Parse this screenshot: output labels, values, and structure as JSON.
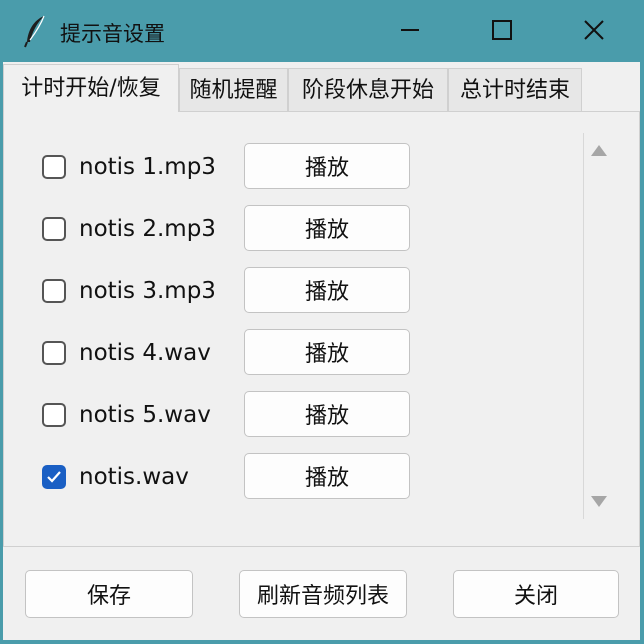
{
  "window": {
    "title": "提示音设置",
    "icon": "feather-icon",
    "controls": {
      "minimize": "minimize-icon",
      "maximize": "maximize-icon",
      "close": "close-icon"
    }
  },
  "tabs": [
    {
      "label": "计时开始/恢复",
      "active": true
    },
    {
      "label": "随机提醒",
      "active": false
    },
    {
      "label": "阶段休息开始",
      "active": false
    },
    {
      "label": "总计时结束",
      "active": false
    }
  ],
  "sounds": [
    {
      "file": "notis 1.mp3",
      "checked": false,
      "play_label": "播放"
    },
    {
      "file": "notis 2.mp3",
      "checked": false,
      "play_label": "播放"
    },
    {
      "file": "notis 3.mp3",
      "checked": false,
      "play_label": "播放"
    },
    {
      "file": "notis 4.wav",
      "checked": false,
      "play_label": "播放"
    },
    {
      "file": "notis 5.wav",
      "checked": false,
      "play_label": "播放"
    },
    {
      "file": "notis.wav",
      "checked": true,
      "play_label": "播放"
    }
  ],
  "footer": {
    "save_label": "保存",
    "refresh_label": "刷新音频列表",
    "close_label": "关闭"
  },
  "colors": {
    "titlebar": "#4a9cab",
    "checkbox_checked": "#1a5fc4",
    "panel_bg": "#f0f0f0"
  }
}
